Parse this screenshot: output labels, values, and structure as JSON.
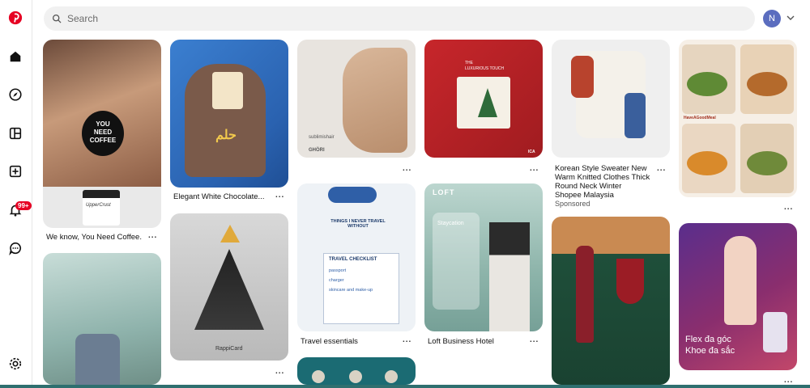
{
  "search": {
    "placeholder": "Search"
  },
  "account": {
    "initial": "N"
  },
  "notifications": {
    "badge": "99+"
  },
  "pins": [
    {
      "id": "coffee",
      "caption": "We know, You Need Coffee.",
      "overlay": [
        "YOU",
        "NEED",
        "COFFEE"
      ],
      "cup_text": "UpperCrust"
    },
    {
      "id": "chocolate",
      "caption": "Elegant White Chocolate..."
    },
    {
      "id": "skincare",
      "overlay": [
        "sublimishair",
        "GHÖRI"
      ]
    },
    {
      "id": "calendar",
      "overlay": [
        "THE",
        "LUXURIOUS TOUCH",
        "ICA"
      ]
    },
    {
      "id": "sweater",
      "caption": "Korean Style Sweater New Warm Knitted Clothes Thick Round Neck Winter",
      "sub1": "Shopee Malaysia",
      "sub2": "Sponsored"
    },
    {
      "id": "food",
      "overlay": [
        "HaveAGoodMeal"
      ]
    },
    {
      "id": "window"
    },
    {
      "id": "rappi",
      "overlay": [
        "RappiCard"
      ]
    },
    {
      "id": "travel",
      "caption": "Travel essentials",
      "overlay": [
        "THINGS I NEVER TRAVEL WITHOUT",
        "TRAVEL CHECKLIST",
        "passport",
        "charger",
        "skincare and make-up"
      ]
    },
    {
      "id": "loft",
      "caption": "Loft Business Hotel",
      "overlay": [
        "LOFT",
        "Staycation"
      ]
    },
    {
      "id": "wine"
    },
    {
      "id": "flex",
      "overlay": [
        "Flex đa góc",
        "Khoe đa sắc"
      ]
    },
    {
      "id": "teal"
    }
  ]
}
